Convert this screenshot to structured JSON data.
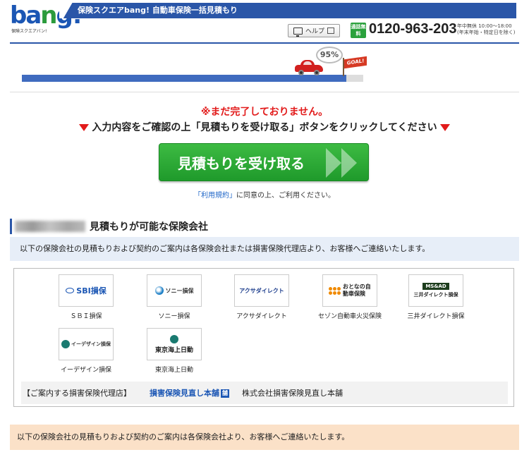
{
  "header": {
    "logo_text": "bang!",
    "logo_subtext": "保険スクエアバン!",
    "title": "保険スクエアbang! 自動車保険一括見積もり",
    "help_label": "ヘルプ",
    "free_badge": "通話無料",
    "phone": "0120-963-203",
    "hours_line1": "年中無休 10:00～18:00",
    "hours_line2": "(年末年始・特定日を除く)"
  },
  "progress": {
    "percent_value": 95,
    "percent_label": "95%",
    "goal_label": "GOAL!"
  },
  "alert": {
    "warning": "※まだ完了しておりません。",
    "instruction": "入力内容をご確認の上「見積もりを受け取る」ボタンをクリックしてください"
  },
  "cta": {
    "label": "見積もりを受け取る"
  },
  "terms": {
    "link": "「利用規約」",
    "rest": "に同意の上、ご利用ください。"
  },
  "companies": {
    "heading": "見積もりが可能な保険会社",
    "note": "以下の保険会社の見積もりおよび契約のご案内は各保険会社または損害保険代理店より、お客様へご連絡いたします。",
    "items": [
      {
        "name": "ＳＢＩ損保",
        "logo": "SBI損保"
      },
      {
        "name": "ソニー損保",
        "logo": "ソニー損保"
      },
      {
        "name": "アクサダイレクト",
        "logo": "アクサダイレクト"
      },
      {
        "name": "セゾン自動車火災保険",
        "logo": "おとなの自動車保険"
      },
      {
        "name": "三井ダイレクト損保",
        "logo": "三井ダイレクト損保",
        "logo_bar": "MS&AD"
      },
      {
        "name": "イーデザイン損保",
        "logo": "イーデザイン損保"
      },
      {
        "name": "東京海上日動",
        "logo": "東京海上日動"
      }
    ],
    "agency_label": "【ご案内する損害保険代理店】",
    "agency_logo": "損害保険見直し本舗",
    "agency_logo_mark": "舗",
    "agency_name": "株式会社損害保険見直し本舗"
  },
  "footer_note": "以下の保険会社の見積もりおよび契約のご案内は各保険会社より、お客様へご連絡いたします。",
  "colors": {
    "brand_blue": "#2a56a8",
    "warning_red": "#e21b1b",
    "cta_green": "#2aa33a",
    "note_blue_bg": "#e7eef8",
    "note_orange_bg": "#fbe1c8"
  }
}
